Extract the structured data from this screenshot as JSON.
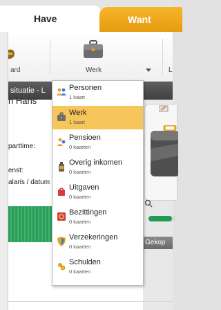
{
  "tabs": {
    "have": "Have",
    "want": "Want"
  },
  "toolbar": {
    "items": [
      {
        "label": "ard",
        "icon": "moneybag-icon"
      },
      {
        "label": "Werk",
        "icon": "briefcase-icon"
      },
      {
        "label": "L",
        "icon": ""
      }
    ]
  },
  "strip": {
    "text": "situatie - L"
  },
  "main": {
    "name": "n Hans",
    "parttime_label": "parttime:",
    "dienst_label": "enst:",
    "salaris_label": "alaris / datum"
  },
  "right": {
    "bought_label": "Gekop",
    "progress": 0.85
  },
  "dropdown": {
    "items": [
      {
        "label": "Personen",
        "count": "1 kaart",
        "icon": "people-icon",
        "selected": false
      },
      {
        "label": "Werk",
        "count": "1 kaart",
        "icon": "briefcase-icon",
        "selected": true
      },
      {
        "label": "Pensioen",
        "count": "0 kaarten",
        "icon": "pension-icon",
        "selected": false
      },
      {
        "label": "Overig inkomen",
        "count": "0 kaarten",
        "icon": "bottle-icon",
        "selected": false
      },
      {
        "label": "Uitgaven",
        "count": "0 kaarten",
        "icon": "shopping-bag-icon",
        "selected": false
      },
      {
        "label": "Bezittingen",
        "count": "0 kaarten",
        "icon": "safe-icon",
        "selected": false
      },
      {
        "label": "Verzekeringen",
        "count": "0 kaarten",
        "icon": "shield-icon",
        "selected": false
      },
      {
        "label": "Schulden",
        "count": "0 kaarten",
        "icon": "debt-icon",
        "selected": false
      }
    ]
  },
  "colors": {
    "accent": "#f6b52b",
    "selected": "#f6c65a",
    "green": "#1f9b52",
    "strip": "#4a4a4a"
  }
}
